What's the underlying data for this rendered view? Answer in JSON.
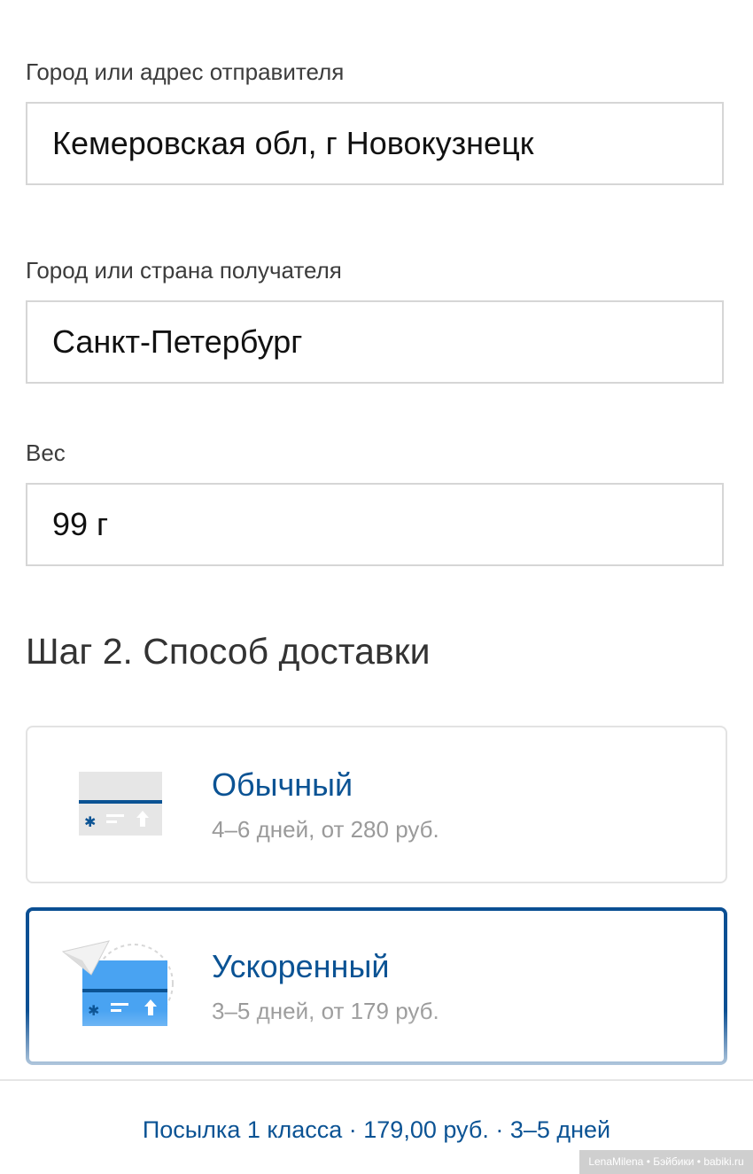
{
  "sender": {
    "label": "Город или адрес отправителя",
    "value": "Кемеровская обл, г Новокузнецк"
  },
  "recipient": {
    "label": "Город или страна получателя",
    "value": "Санкт-Петербург"
  },
  "weight": {
    "label": "Вес",
    "value": "99 г"
  },
  "step": {
    "title": "Шаг 2. Способ доставки"
  },
  "delivery_options": [
    {
      "title": "Обычный",
      "subtitle": "4–6 дней, от 280 руб.",
      "selected": false,
      "icon": "envelope-icon"
    },
    {
      "title": "Ускоренный",
      "subtitle": "3–5 дней, от 179 руб.",
      "selected": true,
      "icon": "express-envelope-icon"
    }
  ],
  "footer": {
    "summary": "Посылка 1 класса · 179,00 руб. · 3–5 дней"
  },
  "watermark": "LenaMilena • Бэйбики • babiki.ru",
  "colors": {
    "accent": "#0b5394",
    "selected_border": "#0b4f93",
    "muted_text": "#9a9a9a",
    "field_border": "#d6d6d6"
  }
}
